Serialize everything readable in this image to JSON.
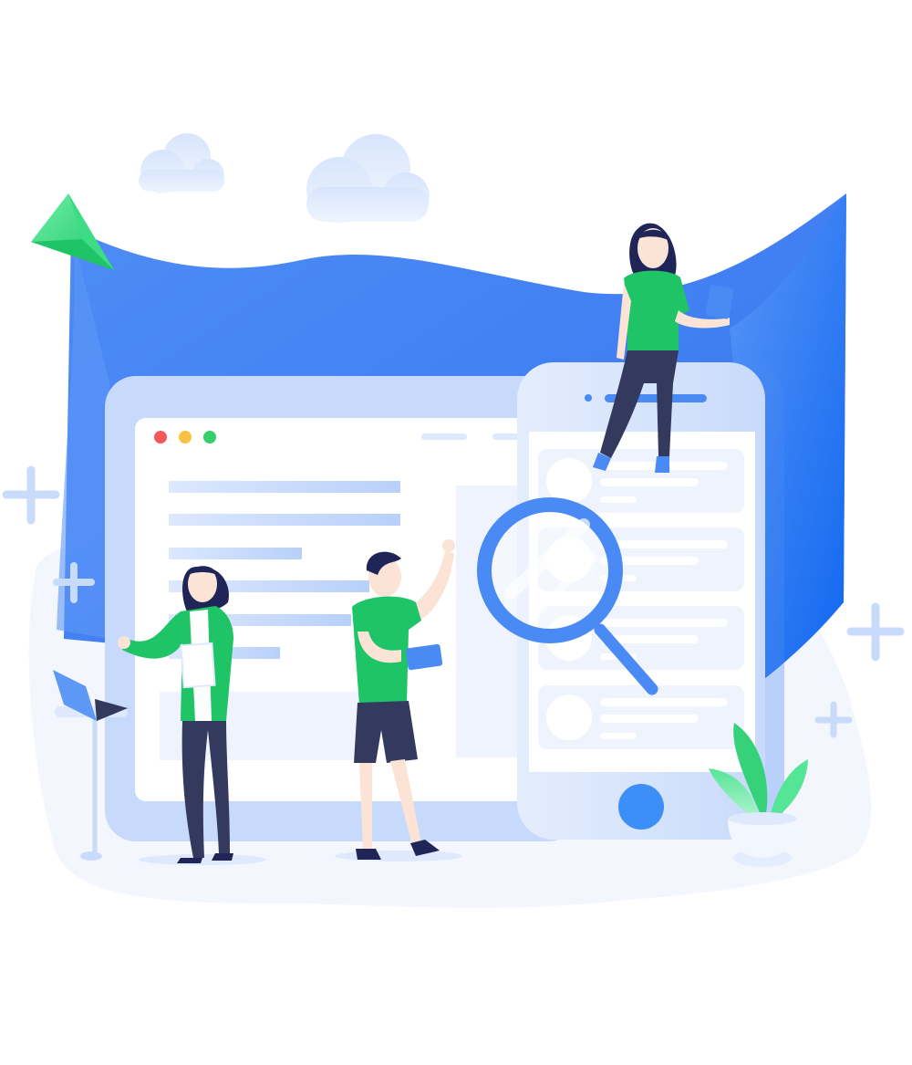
{
  "illustration": {
    "palette": {
      "background": "#ffffff",
      "backdrop_blob": "#f3f6fd",
      "blue_banner": "#4a8af4",
      "blue_banner_light": "#3d74ee",
      "device_frame": "#c8dafb",
      "screen": "#ffffff",
      "placeholder_bar": "#c9dbfb",
      "placeholder_card": "#eef3fd",
      "character_shirt": "#1ec466",
      "character_pants": "#34395e",
      "character_hair": "#1f2556",
      "character_skin": "#fbe3d6",
      "accent_green": "#2dd97a",
      "home_button": "#3d8ff8",
      "magnifier": "#4a8af4",
      "window_dot_red": "#f25a5a",
      "window_dot_yellow": "#f7c244",
      "window_dot_green": "#35d06b"
    },
    "icons": [
      "cloud-icon",
      "paper-plane-icon",
      "plus-icon",
      "browser-window-icon",
      "smartphone-icon",
      "magnifying-glass-icon",
      "laptop-icon",
      "potted-plant-icon",
      "tablet-icon",
      "document-icon"
    ],
    "characters": [
      "woman-sitting-on-phone",
      "woman-with-document",
      "man-waving"
    ]
  }
}
